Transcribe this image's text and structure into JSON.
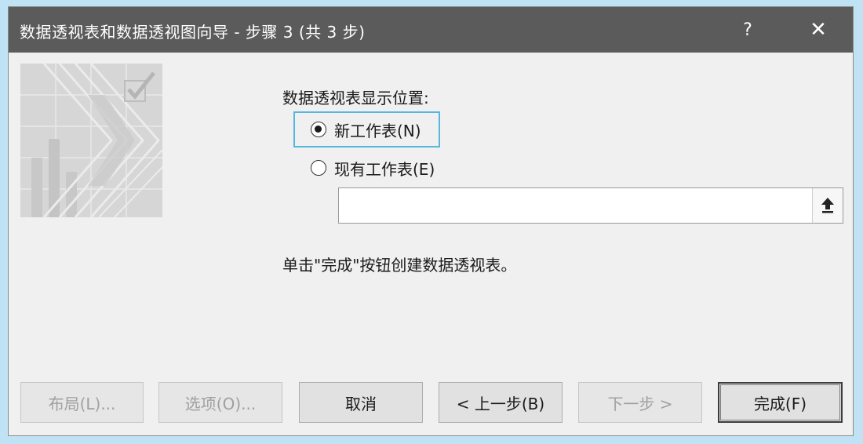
{
  "window": {
    "title": "数据透视表和数据透视图向导 - 步骤 3 (共 3 步)",
    "help_label": "?",
    "close_label": "✕"
  },
  "content": {
    "location_label": "数据透视表显示位置:",
    "options": [
      {
        "label": "新工作表(N)",
        "checked": true
      },
      {
        "label": "现有工作表(E)",
        "checked": false
      }
    ],
    "range_input": {
      "value": "",
      "placeholder": ""
    },
    "instruction": "单击\"完成\"按钮创建数据透视表。"
  },
  "buttons": {
    "layout": "布局(L)...",
    "options": "选项(O)...",
    "cancel": "取消",
    "back": "< 上一步(B)",
    "next": "下一步 >",
    "finish": "完成(F)"
  },
  "icons": {
    "wizard": "pivot-wizard-icon",
    "collapse": "collapse-dialog-icon",
    "close": "close-icon",
    "help": "help-icon"
  },
  "colors": {
    "outer_background": "#bfe3f4",
    "titlebar": "#5b5b5b",
    "dialog_background": "#f0f0f0",
    "focus_border": "#55b6e0"
  }
}
